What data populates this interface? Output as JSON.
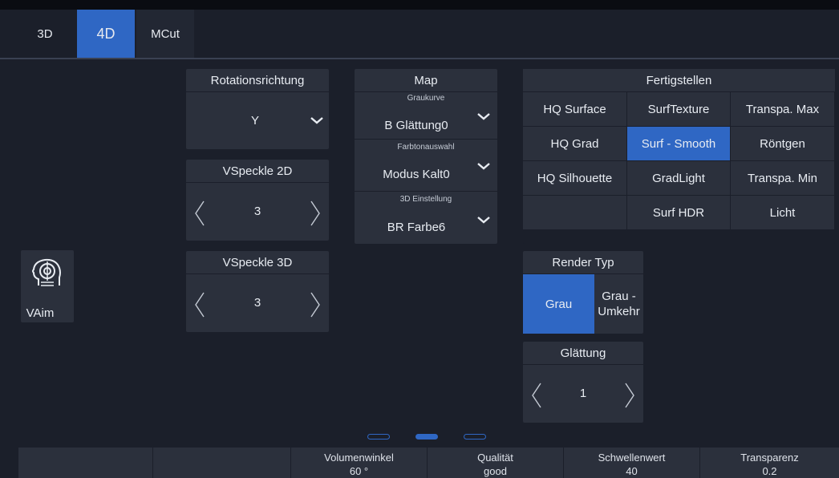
{
  "tabs": [
    {
      "label": "3D"
    },
    {
      "label": "4D"
    },
    {
      "label": "MCut"
    }
  ],
  "rotation": {
    "title": "Rotationsrichtung",
    "value": "Y"
  },
  "vspeckle2d": {
    "title": "VSpeckle 2D",
    "value": "3"
  },
  "vspeckle3d": {
    "title": "VSpeckle 3D",
    "value": "3"
  },
  "map": {
    "title": "Map",
    "graukurve_label": "Graukurve",
    "graukurve_value": "B Glättung0",
    "farbton_label": "Farbtonauswahl",
    "farbton_value": "Modus Kalt0",
    "einstellung_label": "3D Einstellung",
    "einstellung_value": "BR Farbe6"
  },
  "fertigstellen": {
    "title": "Fertigstellen",
    "cells": [
      "HQ Surface",
      "SurfTexture",
      "Transpa. Max",
      "HQ Grad",
      "Surf - Smooth",
      "Röntgen",
      "HQ Silhouette",
      "GradLight",
      "Transpa. Min",
      "",
      "Surf HDR",
      "Licht"
    ],
    "selected": "Surf - Smooth"
  },
  "render_typ": {
    "title": "Render Typ",
    "option1": "Grau",
    "option2": "Grau - Umkehr",
    "selected": "Grau"
  },
  "glaettung": {
    "title": "Glättung",
    "value": "1"
  },
  "vaim": {
    "label": "VAim"
  },
  "pager": {
    "pages": 3,
    "active": 2
  },
  "footer": [
    {
      "label": "",
      "value": ""
    },
    {
      "label": "",
      "value": ""
    },
    {
      "label": "Volumenwinkel",
      "value": "60 °"
    },
    {
      "label": "Qualität",
      "value": "good"
    },
    {
      "label": "Schwellenwert",
      "value": "40"
    },
    {
      "label": "Transparenz",
      "value": "0.2"
    }
  ],
  "colors": {
    "accent": "#2f67c4",
    "panel": "#2b303c",
    "background": "#1b1f2a"
  }
}
